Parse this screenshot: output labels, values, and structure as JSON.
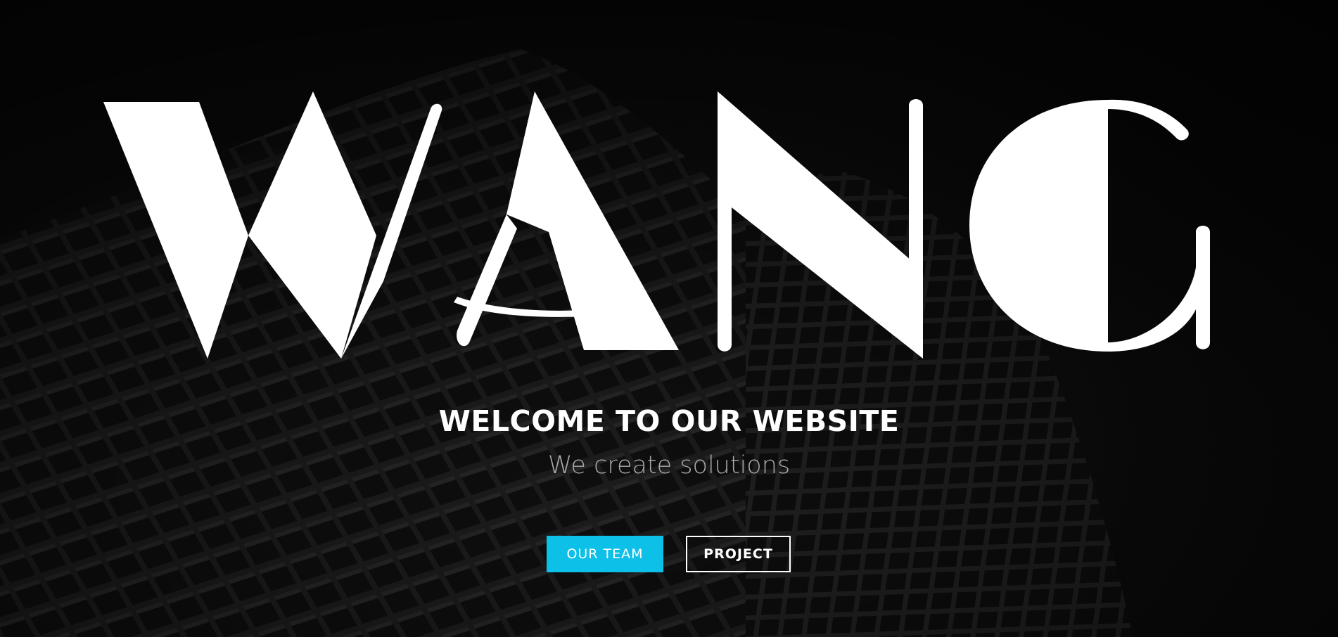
{
  "hero": {
    "logo_text": "WANG",
    "welcome": "WELCOME TO OUR WEBSITE",
    "tagline": "We create solutions",
    "background": "dark-building-photo"
  },
  "buttons": {
    "team_label": "OUR TEAM",
    "project_label": "PROJECT"
  },
  "colors": {
    "accent": "#0cc0e8",
    "text": "#ffffff",
    "tagline": "#a9a9a9",
    "background": "#0b0b0b"
  }
}
